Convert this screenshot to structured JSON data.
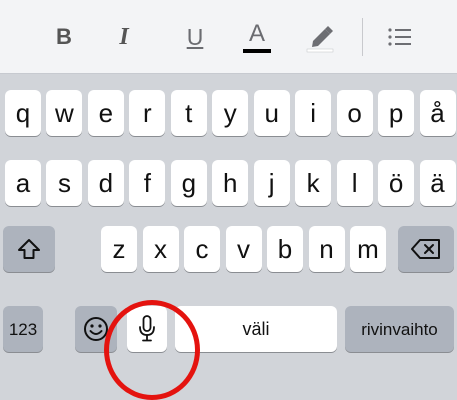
{
  "toolbar": {
    "buttons": [
      {
        "name": "bold-button",
        "icon": "bold-icon",
        "label": "B"
      },
      {
        "name": "italic-button",
        "icon": "italic-icon",
        "label": "I"
      },
      {
        "name": "underline-button",
        "icon": "underline-icon",
        "label": "U"
      },
      {
        "name": "text-color-button",
        "icon": "text-color-icon",
        "label": "A"
      },
      {
        "name": "highlight-button",
        "icon": "highlighter-icon"
      },
      {
        "name": "list-button",
        "icon": "list-icon"
      }
    ]
  },
  "keyboard": {
    "row1": [
      "q",
      "w",
      "e",
      "r",
      "t",
      "y",
      "u",
      "i",
      "o",
      "p",
      "å"
    ],
    "row2": [
      "a",
      "s",
      "d",
      "f",
      "g",
      "h",
      "j",
      "k",
      "l",
      "ö",
      "ä"
    ],
    "row3": [
      "z",
      "x",
      "c",
      "v",
      "b",
      "n",
      "m"
    ],
    "shift_icon": "shift-icon",
    "delete_icon": "backspace-icon",
    "numbers_label": "123",
    "emoji_icon": "emoji-icon",
    "mic_icon": "microphone-icon",
    "space_label": "väli",
    "return_label": "rivinvaihto"
  },
  "annotation": {
    "color": "#e4130f",
    "target": "microphone-icon"
  }
}
